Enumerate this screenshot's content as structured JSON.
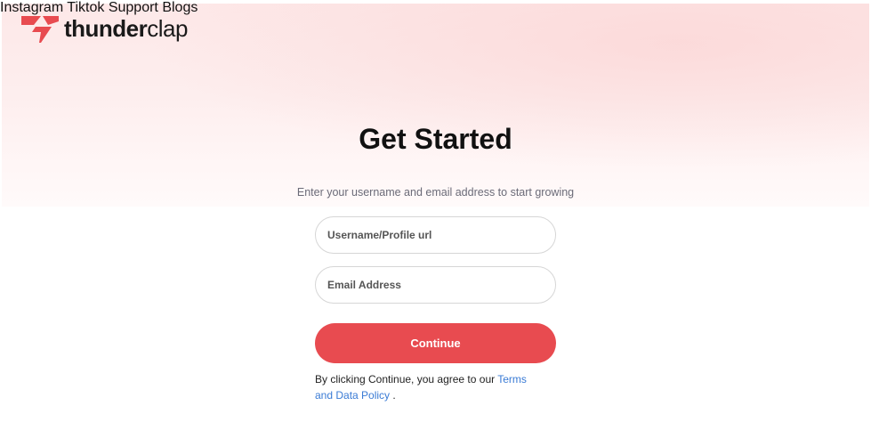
{
  "header": {
    "logo_bold": "thunder",
    "logo_light": "clap",
    "brand_color": "#e84b50",
    "nav": [
      {
        "label": "Instagram"
      },
      {
        "label": "Tiktok"
      },
      {
        "label": "Support"
      },
      {
        "label": "Blogs"
      }
    ]
  },
  "main": {
    "title": "Get Started",
    "subtitle": "Enter your username and email address to start growing",
    "username_field": {
      "placeholder": "Username/Profile url",
      "value": ""
    },
    "email_field": {
      "placeholder": "Email Address",
      "value": ""
    },
    "continue_label": "Continue",
    "terms_prefix": "By clicking Continue, you agree to our",
    "terms_link": "Terms and Data Policy",
    "terms_suffix": "."
  }
}
